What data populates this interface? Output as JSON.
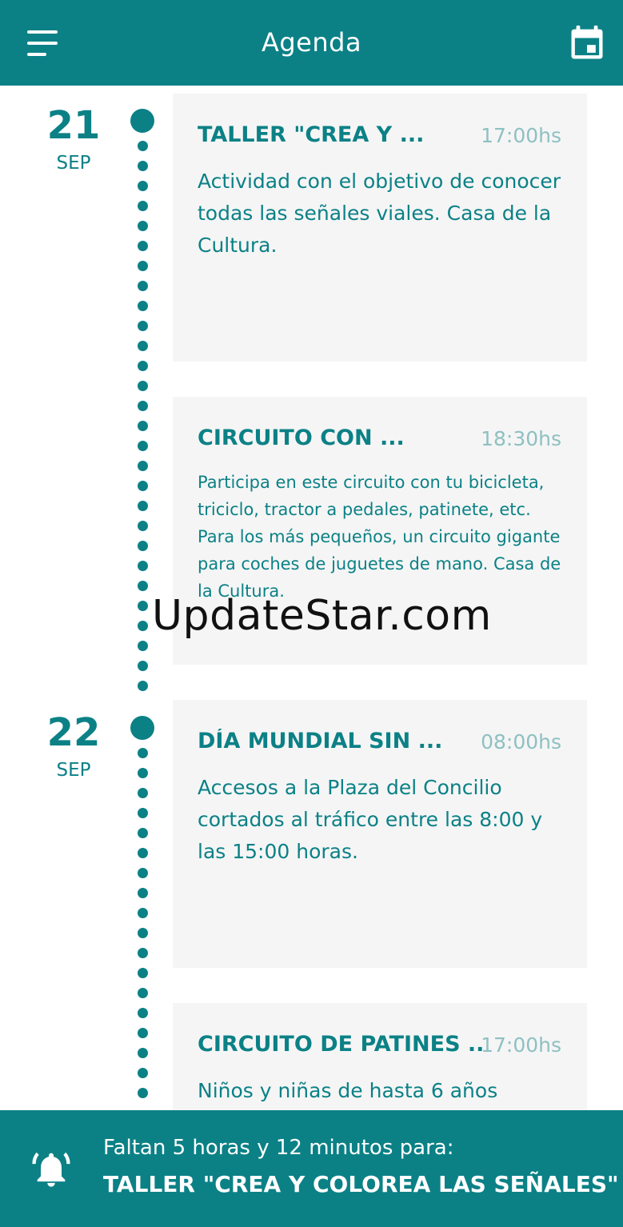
{
  "header": {
    "title": "Agenda",
    "menu_icon": "menu-icon",
    "calendar_icon": "calendar-icon"
  },
  "days": [
    {
      "day": "21",
      "month": "SEP"
    },
    {
      "day": "22",
      "month": "SEP"
    }
  ],
  "events": [
    {
      "title": "TALLER \"CREA Y ...",
      "time": "17:00hs",
      "description": "Actividad con el objetivo de conocer todas las señales viales. Casa de la Cultura."
    },
    {
      "title": "CIRCUITO CON ...",
      "time": "18:30hs",
      "description": "Participa en este circuito con tu bicicleta, triciclo, tractor a pedales, patinete, etc. Para los más pequeños, un circuito gigante para coches de juguetes de mano. Casa de la Cultura."
    },
    {
      "title": "DÍA MUNDIAL SIN ...",
      "time": "08:00hs",
      "description": "Accesos a la Plaza del Concilio cortados al tráfico entre las 8:00 y las 15:00 horas."
    },
    {
      "title": "CIRCUITO DE PATINES ...",
      "time": "17:00hs",
      "description": "Niños y niñas de hasta 6 años"
    }
  ],
  "watermark": "UpdateStar.com",
  "footer": {
    "bell_icon": "bell-icon",
    "countdown": "Faltan 5 horas y 12 minutos para:",
    "next_event": "TALLER \"CREA Y COLOREA LAS SEÑALES\""
  },
  "colors": {
    "primary": "#0b8186",
    "card_bg": "#f5f5f5",
    "time_text": "#8fc0c2"
  }
}
